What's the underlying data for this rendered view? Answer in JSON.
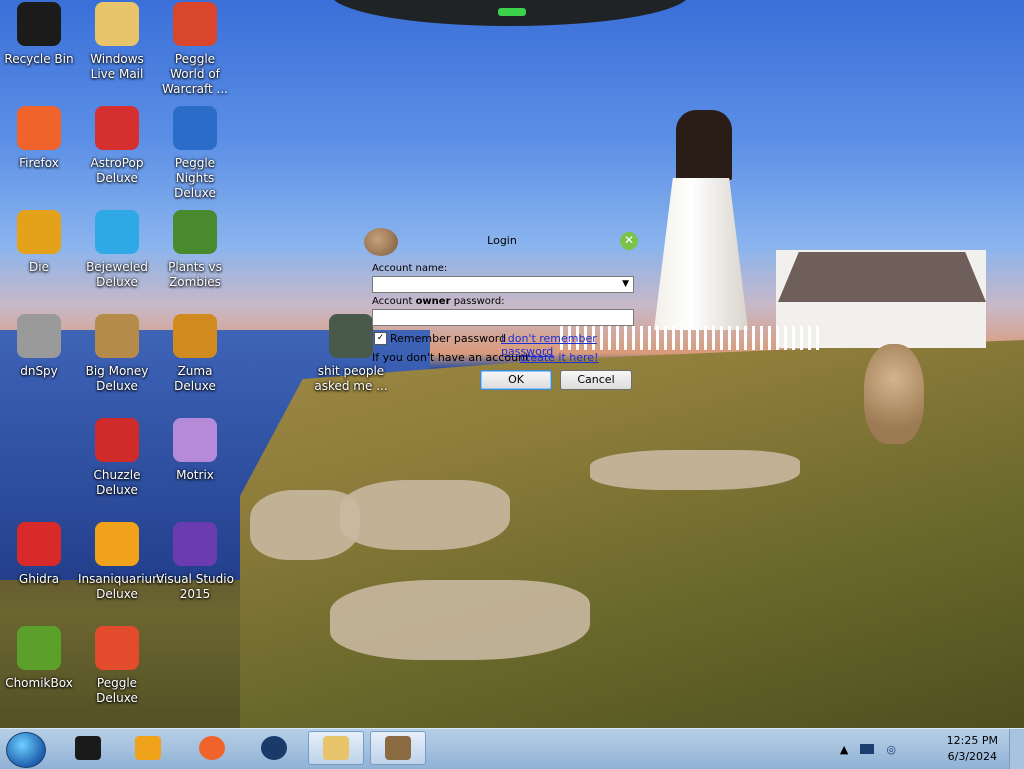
{
  "desktop": {
    "icons": [
      {
        "label": "Recycle Bin",
        "icon": "recycle-bin-icon",
        "color": "#1b1b1b"
      },
      {
        "label": "Windows Live Mail",
        "icon": "mail-icon",
        "color": "#e8c56b"
      },
      {
        "label": "Peggle World of Warcraft ...",
        "icon": "peggle-icon",
        "color": "#d9462b"
      },
      {
        "label": "Firefox",
        "icon": "firefox-icon",
        "color": "#f0632a"
      },
      {
        "label": "AstroPop Deluxe",
        "icon": "astropop-icon",
        "color": "#d62f2f"
      },
      {
        "label": "Peggle Nights Deluxe",
        "icon": "peggle-nights-icon",
        "color": "#2a6cc8"
      },
      {
        "label": "Die",
        "icon": "die-icon",
        "color": "#e4a21b"
      },
      {
        "label": "Bejeweled Deluxe",
        "icon": "gem-icon",
        "color": "#2ea9e6"
      },
      {
        "label": "Plants vs Zombies",
        "icon": "plant-icon",
        "color": "#4a8a2f"
      },
      {
        "label": "dnSpy",
        "icon": "dnspy-icon",
        "color": "#9a9a9a"
      },
      {
        "label": "Big Money Deluxe",
        "icon": "money-bag-icon",
        "color": "#b58b4a"
      },
      {
        "label": "Zuma Deluxe",
        "icon": "zuma-icon",
        "color": "#d08a1e"
      },
      {
        "label": "Chuzzle Deluxe",
        "icon": "chuzzle-icon",
        "color": "#d02a2a"
      },
      {
        "label": "Motrix",
        "icon": "motrix-icon",
        "color": "#b58bd9"
      },
      {
        "label": "Ghidra",
        "icon": "ghidra-icon",
        "color": "#d82a2a"
      },
      {
        "label": "Insaniquarium Deluxe",
        "icon": "fish-icon",
        "color": "#f0a21b"
      },
      {
        "label": "Visual Studio 2015",
        "icon": "visual-studio-icon",
        "color": "#6b3cb0"
      },
      {
        "label": "ChomikBox",
        "icon": "chomikbox-icon",
        "color": "#5aa02a"
      },
      {
        "label": "Peggle Deluxe",
        "icon": "peggle-deluxe-icon",
        "color": "#e24b2b"
      },
      {
        "label": "shit people asked me ...",
        "icon": "folder-icon",
        "color": "#4a5a4a"
      }
    ]
  },
  "login": {
    "title": "Login",
    "account_name_label": "Account name:",
    "password_label_prefix": "Account ",
    "password_label_bold": "owner",
    "password_label_suffix": " password:",
    "account_name_value": "",
    "password_value": "",
    "remember_label": "Remember password",
    "remember_checked": "✓",
    "forgot_link": "I don't remember password",
    "no_account_text": "If you don't have an account -",
    "create_link": "create it here!",
    "ok_label": "OK",
    "cancel_label": "Cancel"
  },
  "taskbar": {
    "clock_time": "12:25 PM",
    "clock_date": "6/3/2024"
  }
}
